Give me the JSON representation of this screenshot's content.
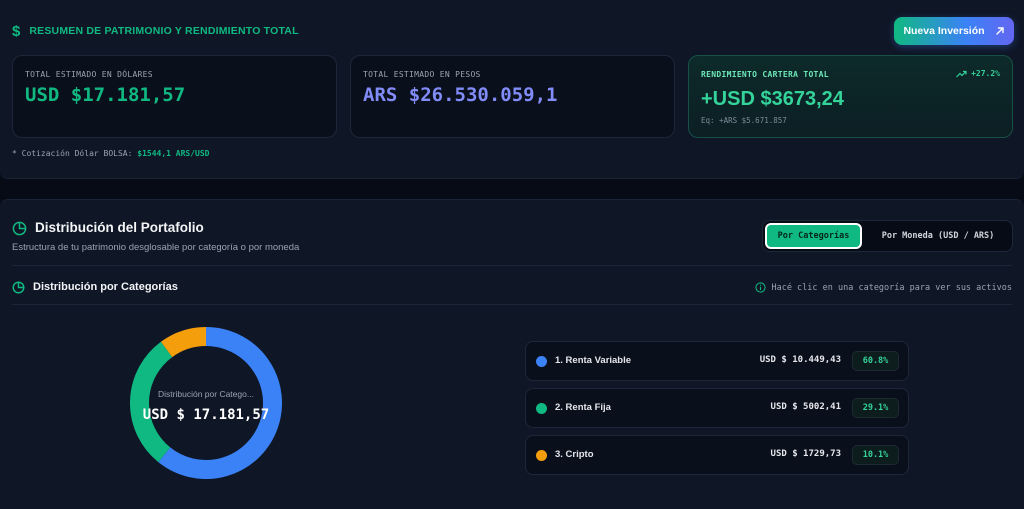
{
  "summary": {
    "title": "RESUMEN DE PATRIMONIO Y RENDIMIENTO TOTAL",
    "new_investment_label": "Nueva Inversión",
    "usd_card": {
      "label": "TOTAL ESTIMADO EN DÓLARES",
      "value": "USD $17.181,57"
    },
    "ars_card": {
      "label": "TOTAL ESTIMADO EN PESOS",
      "value": "ARS $26.530.059,1"
    },
    "performance_card": {
      "label": "RENDIMIENTO CARTERA TOTAL",
      "change": "+27.2%",
      "value": "+USD $3673,24",
      "equivalent": "Eq: +ARS $5.671.857"
    },
    "rate_prefix": "* Cotización Dólar BOLSA:",
    "rate_value": "$1544,1 ARS/USD"
  },
  "distribution": {
    "title": "Distribución del Portafolio",
    "subtitle": "Estructura de tu patrimonio desglosable por categoría o por moneda",
    "tabs": {
      "categories": "Por Categorías",
      "currency": "Por Moneda (USD / ARS)",
      "active": "categories"
    },
    "section_title": "Distribución por Categorías",
    "hint": "Hacé clic en una categoría para ver sus activos",
    "donut_label": "Distribución por Catego...",
    "donut_total": "USD $ 17.181,57",
    "categories": [
      {
        "name": "1. Renta Variable",
        "amount": "USD $ 10.449,43",
        "percent": "60.8%",
        "share": 60.8,
        "color": "#3b82f6"
      },
      {
        "name": "2. Renta Fija",
        "amount": "USD $ 5002,41",
        "percent": "29.1%",
        "share": 29.1,
        "color": "#10b981"
      },
      {
        "name": "3. Cripto",
        "amount": "USD $ 1729,73",
        "percent": "10.1%",
        "share": 10.1,
        "color": "#f59e0b"
      }
    ]
  },
  "icons": {
    "summary": "dollar-icon",
    "new_investment": "arrow-up-right-icon",
    "performance": "trending-up-icon",
    "distribution": "pie-chart-icon",
    "hint": "info-icon"
  }
}
